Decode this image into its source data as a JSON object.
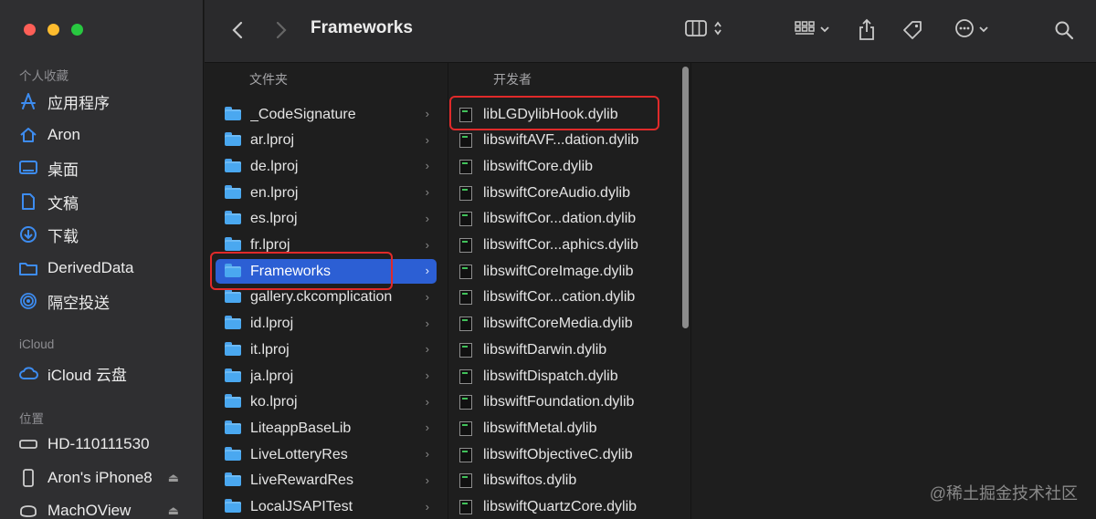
{
  "toolbar": {
    "title": "Frameworks"
  },
  "sidebar": {
    "sections": [
      {
        "title": "个人收藏"
      },
      {
        "title": "iCloud"
      },
      {
        "title": "位置"
      }
    ],
    "favorites": [
      {
        "label": "应用程序",
        "icon": "applications-icon"
      },
      {
        "label": "Aron",
        "icon": "home-icon"
      },
      {
        "label": "桌面",
        "icon": "desktop-icon"
      },
      {
        "label": "文稿",
        "icon": "documents-icon"
      },
      {
        "label": "下载",
        "icon": "downloads-icon"
      },
      {
        "label": "DerivedData",
        "icon": "folder-icon"
      },
      {
        "label": "隔空投送",
        "icon": "airdrop-icon"
      }
    ],
    "icloud": [
      {
        "label": "iCloud 云盘",
        "icon": "icloud-icon"
      }
    ],
    "locations": [
      {
        "label": "HD-110111530",
        "icon": "drive-icon"
      },
      {
        "label": "Aron's iPhone8",
        "icon": "iphone-icon"
      },
      {
        "label": "MachOView",
        "icon": "disk-icon"
      }
    ]
  },
  "columns": {
    "col1_header": "文件夹",
    "col1_items": [
      "_CodeSignature",
      "ar.lproj",
      "de.lproj",
      "en.lproj",
      "es.lproj",
      "fr.lproj",
      "Frameworks",
      "gallery.ckcomplication",
      "id.lproj",
      "it.lproj",
      "ja.lproj",
      "ko.lproj",
      "LiteappBaseLib",
      "LiveLotteryRes",
      "LiveRewardRes",
      "LocalJSAPITest"
    ],
    "col1_selected": "Frameworks",
    "col2_header": "开发者",
    "col2_items": [
      "libLGDylibHook.dylib",
      "libswiftAVF...dation.dylib",
      "libswiftCore.dylib",
      "libswiftCoreAudio.dylib",
      "libswiftCor...dation.dylib",
      "libswiftCor...aphics.dylib",
      "libswiftCoreImage.dylib",
      "libswiftCor...cation.dylib",
      "libswiftCoreMedia.dylib",
      "libswiftDarwin.dylib",
      "libswiftDispatch.dylib",
      "libswiftFoundation.dylib",
      "libswiftMetal.dylib",
      "libswiftObjectiveC.dylib",
      "libswiftos.dylib",
      "libswiftQuartzCore.dylib"
    ]
  },
  "watermark": "@稀土掘金技术社区",
  "colors": {
    "selection": "#2c5fd4",
    "highlight_box": "#e02a2a",
    "folder": "#4aa8f0"
  }
}
